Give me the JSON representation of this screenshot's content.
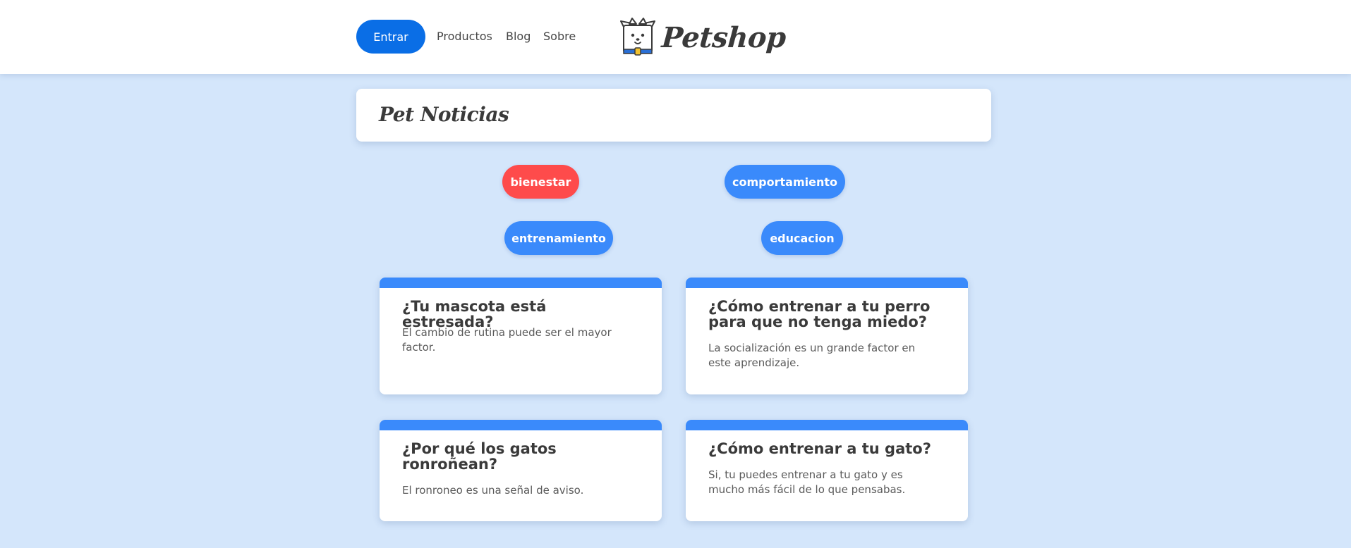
{
  "header": {
    "login_label": "Entrar",
    "nav": [
      "Productos",
      "Blog",
      "Sobre"
    ],
    "logo_text": "Petshop",
    "logo_icon": "dog-box-icon"
  },
  "main": {
    "title": "Pet Noticias",
    "tags": [
      {
        "label": "bienestar",
        "color": "#fe4b4b"
      },
      {
        "label": "comportamiento",
        "color": "#3a8afb"
      },
      {
        "label": "entrenamiento",
        "color": "#3a8afb"
      },
      {
        "label": "educacion",
        "color": "#3a8afb"
      }
    ],
    "cards": [
      {
        "title": "¿Tu mascota está estresada?",
        "text": "El cambio de rutina puede ser el mayor factor."
      },
      {
        "title": "¿Cómo entrenar a tu perro para que no tenga miedo?",
        "text": "La socialización es un grande factor en este aprendizaje."
      },
      {
        "title": "¿Por qué los gatos ronroñean?",
        "text": "El ronroneo es una señal de aviso."
      },
      {
        "title": "¿Cómo entrenar a tu gato?",
        "text": "Si, tu puedes entrenar a tu gato y es mucho más fácil de lo que pensabas."
      }
    ]
  },
  "colors": {
    "background": "#d4e6fb",
    "primary": "#0a6ee6",
    "accent_blue": "#3a8afb",
    "accent_red": "#fe4b4b"
  }
}
